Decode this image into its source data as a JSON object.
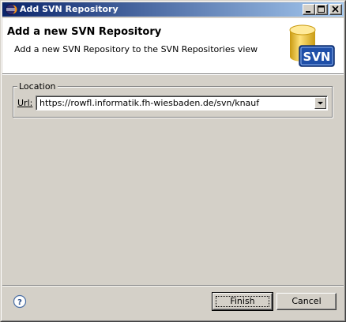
{
  "window": {
    "title": "Add SVN Repository"
  },
  "banner": {
    "title": "Add a new SVN Repository",
    "description": "Add a new SVN Repository to the SVN Repositories view",
    "icon_text": "SVN"
  },
  "location": {
    "group_label": "Location",
    "url_label": "Url:",
    "url_value": "https://rowfl.informatik.fh-wiesbaden.de/svn/knauf"
  },
  "buttons": {
    "finish": "Finish",
    "cancel": "Cancel"
  },
  "colors": {
    "titlebar_start": "#0a246a",
    "titlebar_end": "#a6caf0",
    "face": "#d4d0c8",
    "svn_blue": "#1f4fa8",
    "cylinder_gold": "#f2c230"
  }
}
